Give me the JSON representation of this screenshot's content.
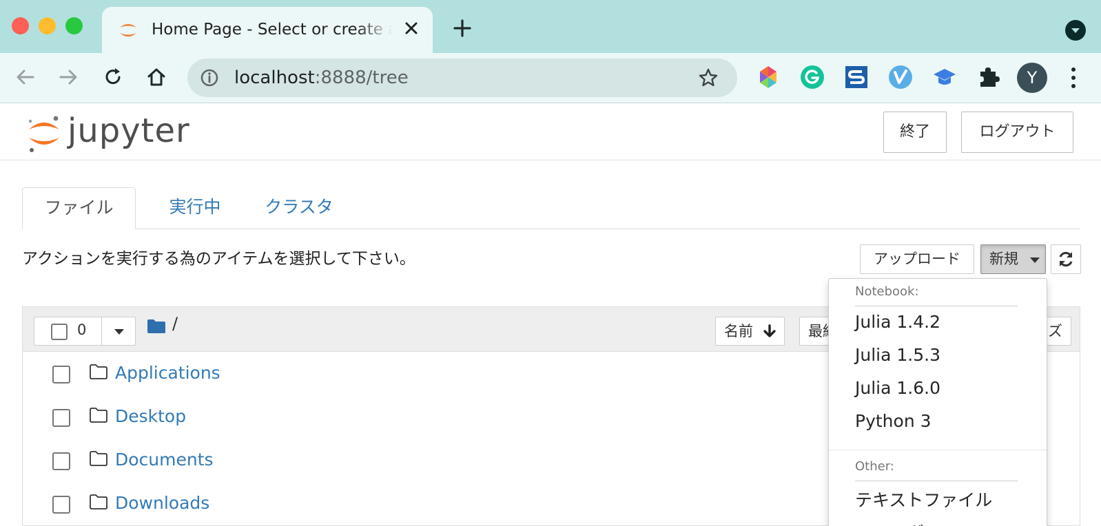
{
  "browser": {
    "tab_title": "Home Page - Select or create a notebook",
    "url_host": "localhost",
    "url_rest": ":8888/tree",
    "profile_initial": "Y",
    "extensions": [
      "color-extension-icon",
      "grammarly-icon",
      "s-extension-icon",
      "v-extension-icon",
      "graduation-cap-icon",
      "puzzle-extensions-icon"
    ]
  },
  "header": {
    "logo_text": "jupyter",
    "quit_label": "終了",
    "logout_label": "ログアウト"
  },
  "tabs": [
    {
      "label": "ファイル",
      "active": true
    },
    {
      "label": "実行中",
      "active": false
    },
    {
      "label": "クラスタ",
      "active": false
    }
  ],
  "toolbar": {
    "hint": "アクションを実行する為のアイテムを選択して下さい。",
    "upload_label": "アップロード",
    "new_label": "新規"
  },
  "list": {
    "selected_count": "0",
    "breadcrumb": "/",
    "sort_name_label": "名前",
    "sort_modified_label": "最終変更時刻",
    "sort_size_label": "ファイルサイズ",
    "items": [
      {
        "name": "Applications"
      },
      {
        "name": "Desktop"
      },
      {
        "name": "Documents"
      },
      {
        "name": "Downloads"
      }
    ]
  },
  "new_menu": {
    "notebook_header": "Notebook:",
    "kernels": [
      "Julia 1.4.2",
      "Julia 1.5.3",
      "Julia 1.6.0",
      "Python 3"
    ],
    "other_header": "Other:",
    "other_items": [
      "テキストファイル",
      "フォルダ"
    ]
  },
  "colors": {
    "tabstrip": "#b2e0de",
    "toolbar": "#ecf8f7",
    "link": "#337ab7",
    "jupyter_orange": "#f37726"
  }
}
